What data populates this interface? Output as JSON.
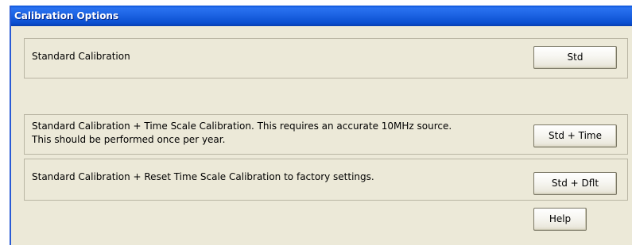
{
  "window": {
    "title": "Calibration Options"
  },
  "groups": [
    {
      "description": [
        "Standard Calibration"
      ],
      "button": "Std"
    },
    {
      "description": [
        "Standard Calibration + Time Scale Calibration.  This requires an accurate 10MHz source.",
        "This should be performed once per year."
      ],
      "button": "Std + Time"
    },
    {
      "description": [
        "Standard Calibration + Reset Time Scale Calibration to factory settings."
      ],
      "button": "Std + Dflt"
    }
  ],
  "help_button": "Help",
  "colors": {
    "titlebar": "#0a4fd0",
    "face": "#ece9d8",
    "border": "#b9b5a3"
  }
}
